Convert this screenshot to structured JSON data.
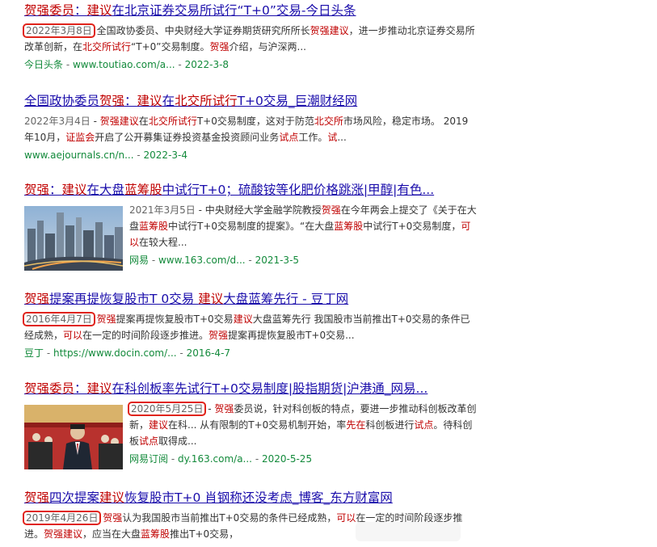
{
  "results": [
    {
      "title_parts": [
        [
          "贺强委员",
          true
        ],
        [
          "：",
          false
        ],
        [
          "建议",
          true
        ],
        [
          "在北京证券交易所试行“T+0”交易-今日头条",
          false
        ]
      ],
      "snippet_parts": [
        [
          "2022年3月8日",
          "date-boxed"
        ],
        [
          " 全国政协委员、中央财经大学证券期货研究所所长",
          ""
        ],
        [
          "贺强建议",
          "hl"
        ],
        [
          "，进一步推动北京证券交易所改革创新，在",
          ""
        ],
        [
          "北交所试行",
          "hl"
        ],
        [
          "“T+0”交易制度。",
          ""
        ],
        [
          "贺强",
          "hl"
        ],
        [
          "介绍，与沪深两...",
          ""
        ]
      ],
      "source": "今日头条",
      "url": "www.toutiao.com/a...",
      "date": "2022-3-8"
    },
    {
      "title_parts": [
        [
          "全国政协委员",
          false
        ],
        [
          "贺强",
          true
        ],
        [
          "：",
          false
        ],
        [
          "建议",
          true
        ],
        [
          "在",
          false
        ],
        [
          "北交所试行",
          true
        ],
        [
          "T+0交易_巨潮财经网",
          false
        ]
      ],
      "snippet_parts": [
        [
          "2022年3月4日",
          "date"
        ],
        [
          " - ",
          ""
        ],
        [
          "贺强建议",
          "hl"
        ],
        [
          "在",
          ""
        ],
        [
          "北交所试行",
          "hl"
        ],
        [
          "T+0交易制度，这对于防范",
          ""
        ],
        [
          "北交所",
          "hl"
        ],
        [
          "市场风险，稳定市场。 2019年10月，",
          ""
        ],
        [
          "证监会",
          "hl"
        ],
        [
          "开启了公开募集证券投资基金投资顾问业务",
          ""
        ],
        [
          "试点",
          "hl"
        ],
        [
          "工作。",
          ""
        ],
        [
          "试",
          "hl"
        ],
        [
          "...",
          ""
        ]
      ],
      "source": "",
      "url": "www.aejournals.cn/n...",
      "date": "2022-3-4"
    },
    {
      "title_parts": [
        [
          "贺强",
          true
        ],
        [
          "：",
          false
        ],
        [
          "建议",
          true
        ],
        [
          "在大盘",
          false
        ],
        [
          "蓝筹股",
          true
        ],
        [
          "中试行T+0；硫酸铵等化肥价格跳涨|甲醇|有色...",
          false
        ]
      ],
      "snippet_parts": [
        [
          "2021年3月5日",
          "date"
        ],
        [
          " - 中央财经大学金融学院教授",
          ""
        ],
        [
          "贺强",
          "hl"
        ],
        [
          "在今年两会上提交了《关于在大盘",
          ""
        ],
        [
          "蓝筹股",
          "hl"
        ],
        [
          "中试行T+0交易制度的提案》。“在大盘",
          ""
        ],
        [
          "蓝筹股",
          "hl"
        ],
        [
          "中试行T+0交易制度，",
          ""
        ],
        [
          "可以",
          "hl"
        ],
        [
          "在较大程...",
          ""
        ]
      ],
      "source": "网易",
      "url": "www.163.com/d...",
      "date": "2021-3-5"
    },
    {
      "title_parts": [
        [
          "贺强",
          true
        ],
        [
          "提案再提恢复股市T 0交易 ",
          false
        ],
        [
          "建议",
          true
        ],
        [
          "大盘蓝筹先行 - 豆丁网",
          false
        ]
      ],
      "snippet_parts": [
        [
          "2016年4月7日",
          "date-boxed"
        ],
        [
          " ",
          ""
        ],
        [
          "贺强",
          "hl"
        ],
        [
          "提案再提恢复股市T+0交易",
          ""
        ],
        [
          "建议",
          "hl"
        ],
        [
          "大盘蓝筹先行 我国股市当前推出T+0交易的条件已经成熟，",
          ""
        ],
        [
          "可以",
          "hl"
        ],
        [
          "在一定的时间阶段逐步推进。",
          ""
        ],
        [
          "贺强",
          "hl"
        ],
        [
          "提案再提恢复股市T+0交易...",
          ""
        ]
      ],
      "source": "豆丁",
      "url": "https://www.docin.com/...",
      "date": "2016-4-7"
    },
    {
      "title_parts": [
        [
          "贺强委员",
          true
        ],
        [
          "：",
          false
        ],
        [
          "建议",
          true
        ],
        [
          "在科创板率先试行T+0交易制度|股指期货|沪港通_网易...",
          false
        ]
      ],
      "snippet_parts": [
        [
          "2020年5月25日",
          "date-boxed"
        ],
        [
          " - ",
          ""
        ],
        [
          "贺强",
          "hl"
        ],
        [
          "委员说，针对科创板的特点，要进一步推动科创板改革创新，",
          ""
        ],
        [
          "建议",
          "hl"
        ],
        [
          "在科... 从有限制的T+0交易机制开始，率",
          ""
        ],
        [
          "先在",
          "hl"
        ],
        [
          "科创板进行",
          ""
        ],
        [
          "试点",
          "hl"
        ],
        [
          "。待科创板",
          ""
        ],
        [
          "试点",
          "hl"
        ],
        [
          "取得成...",
          ""
        ]
      ],
      "source": "网易订阅",
      "url": "dy.163.com/a...",
      "date": "2020-5-25"
    },
    {
      "title_parts": [
        [
          "贺强",
          true
        ],
        [
          "四次提案",
          false
        ],
        [
          "建议",
          true
        ],
        [
          "恢复股市T+0 肖钢称还没考虑_博客_东方财富网",
          false
        ]
      ],
      "snippet_parts": [
        [
          "2019年4月26日",
          "date-boxed"
        ],
        [
          " ",
          ""
        ],
        [
          "贺强",
          "hl"
        ],
        [
          "认为我国股市当前推出T+0交易的条件已经成熟，",
          ""
        ],
        [
          "可以",
          "hl"
        ],
        [
          "在一定的时间阶段逐步推进。",
          ""
        ],
        [
          "贺强建议",
          "hl"
        ],
        [
          "，应当在大盘",
          ""
        ],
        [
          "蓝筹股",
          "hl"
        ],
        [
          "推出T+0交易，",
          ""
        ]
      ],
      "source": "",
      "url": "",
      "date": ""
    }
  ]
}
